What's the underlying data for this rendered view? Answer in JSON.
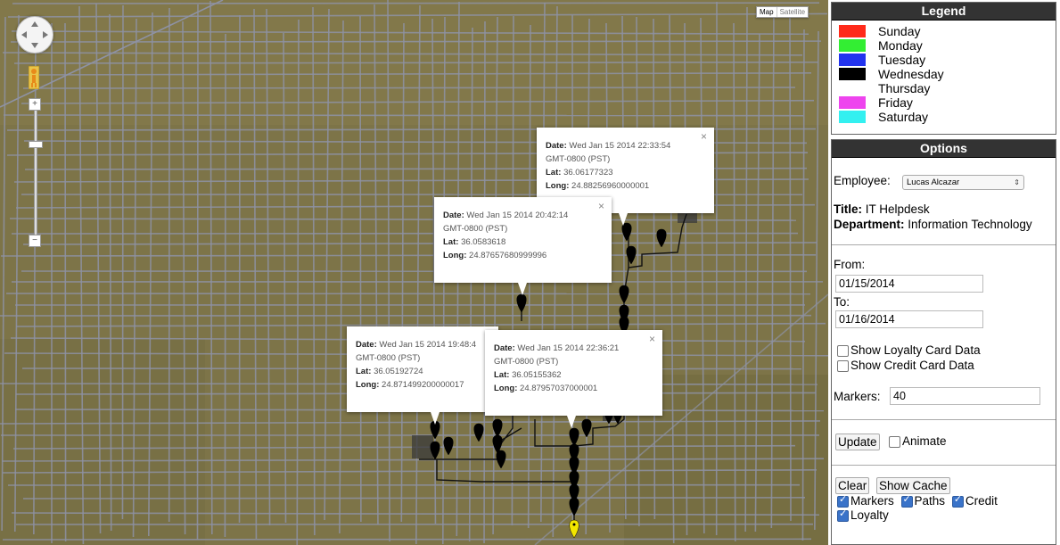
{
  "map": {
    "maptype": {
      "map_label": "Map",
      "satellite_label": "Satellite"
    },
    "popups": [
      {
        "date_label": "Date:",
        "date": "Wed Jan 15 2014 22:33:54",
        "tz": "GMT-0800 (PST)",
        "lat_label": "Lat:",
        "lat": "36.06177323",
        "long_label": "Long:",
        "long": "24.88256960000001"
      },
      {
        "date_label": "Date:",
        "date": "Wed Jan 15 2014 20:42:14",
        "tz": "GMT-0800 (PST)",
        "lat_label": "Lat:",
        "lat": "36.0583618",
        "long_label": "Long:",
        "long": "24.87657680999996"
      },
      {
        "date_label": "Date:",
        "date": "Wed Jan 15 2014 19:48:4",
        "tz": "GMT-0800 (PST)",
        "lat_label": "Lat:",
        "lat": "36.05192724",
        "long_label": "Long:",
        "long": "24.871499200000017"
      },
      {
        "date_label": "Date:",
        "date": "Wed Jan 15 2014 22:36:21",
        "tz": "GMT-0800 (PST)",
        "lat_label": "Lat:",
        "lat": "36.05155362",
        "long_label": "Long:",
        "long": "24.87957037000001"
      }
    ],
    "close_symbol": "×",
    "zoom_in": "+",
    "zoom_out": "−",
    "marker_color": "#000000",
    "current_marker_color": "#f2e600",
    "map_bg_color": "#7d7448",
    "road_color": "#8e92a4"
  },
  "legend": {
    "title": "Legend",
    "items": [
      {
        "label": "Sunday",
        "color": "#ff2a1a"
      },
      {
        "label": "Monday",
        "color": "#33ee33"
      },
      {
        "label": "Tuesday",
        "color": "#2233ee"
      },
      {
        "label": "Wednesday",
        "color": "#000000"
      },
      {
        "label": "Thursday",
        "color": "#ffffff"
      },
      {
        "label": "Friday",
        "color": "#ee44ee"
      },
      {
        "label": "Saturday",
        "color": "#33f0f0"
      }
    ]
  },
  "options": {
    "title": "Options",
    "employee_label": "Employee:",
    "employee_value": "Lucas Alcazar",
    "title_label": "Title:",
    "title_value": "IT Helpdesk",
    "department_label": "Department:",
    "department_value": "Information Technology",
    "from_label": "From:",
    "from_value": "01/15/2014",
    "to_label": "To:",
    "to_value": "01/16/2014",
    "show_loyalty_label": "Show Loyalty Card Data",
    "show_loyalty_checked": false,
    "show_credit_label": "Show Credit Card Data",
    "show_credit_checked": false,
    "markers_label": "Markers:",
    "markers_value": "40",
    "update_label": "Update",
    "animate_label": "Animate",
    "animate_checked": false,
    "clear_label": "Clear",
    "show_cache_label": "Show Cache",
    "layers": [
      {
        "label": "Markers",
        "checked": true
      },
      {
        "label": "Paths",
        "checked": true
      },
      {
        "label": "Credit",
        "checked": true
      },
      {
        "label": "Loyalty",
        "checked": true
      }
    ]
  }
}
